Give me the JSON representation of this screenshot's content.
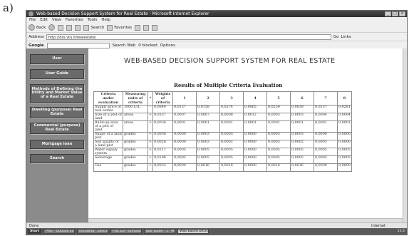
{
  "figure_label": "a)",
  "window": {
    "title": "Web-based Decision Support System for Real Estate - Microsoft Internet Explorer",
    "controls": [
      "_",
      "□",
      "x"
    ]
  },
  "menu": [
    "File",
    "Edit",
    "View",
    "Favorites",
    "Tools",
    "Help"
  ],
  "toolbar": {
    "back": "Back",
    "search": "Search",
    "favorites": "Favorites"
  },
  "address": {
    "label": "Address",
    "value": "http://dss.vtu.lt/realestate/",
    "go": "Go",
    "links": "Links"
  },
  "google": {
    "logo": "Google",
    "search": "Search Web",
    "blocked": "0 blocked",
    "options": "Options"
  },
  "sidebar": {
    "items": [
      {
        "label": "User"
      },
      {
        "label": "User Guide"
      },
      {
        "label": "Methods of Defining the Utility and Market Value of a Real Estate"
      },
      {
        "label": "Dwelling (purpose) Real Estate"
      },
      {
        "label": "Commercial (purpose) Real Estate"
      },
      {
        "label": "Mortgage loan"
      },
      {
        "label": "Search"
      }
    ]
  },
  "main": {
    "app_title": "WEB-BASED DECISION SUPPORT SYSTEM FOR REAL ESTATE",
    "results_title": "Results of Multiple Criteria Evaluation"
  },
  "table": {
    "headers": {
      "criteria": "Criteria under evaluation",
      "units": "Measuring units of criteria",
      "sign": "*",
      "weights": "Weights of criteria",
      "alternatives": [
        "1",
        "2",
        "3",
        "4",
        "5",
        "6",
        "7",
        "8"
      ]
    },
    "rows": [
      {
        "criterion": "Supply price of real estate",
        "unit": "1000 LTL",
        "sign": "-",
        "weight": "0,0640",
        "values": [
          "0,0137",
          "0,0158",
          "0,0274",
          "0,0065",
          "0,0259",
          "0,0039",
          "0,0137",
          "0,0281"
        ]
      },
      {
        "criterion": "Size of a plot of land",
        "unit": "areas",
        "sign": "+",
        "weight": "0,0337",
        "values": [
          "0,0007",
          "0,0007",
          "0,0008",
          "0,0012",
          "0,0003",
          "0,0003",
          "0,0004",
          "0,0004"
        ]
      },
      {
        "criterion": "Build-up area of a plot of land",
        "unit": "areas",
        "sign": "+",
        "weight": "0,0036",
        "values": [
          "0,0001",
          "0,0001",
          "0,0001",
          "0,0001",
          "0,0001",
          "0,0001",
          "0,0001",
          "0,0001"
        ]
      },
      {
        "criterion": "Shape of a land plot",
        "unit": "grades",
        "sign": "+",
        "weight": "0,0036",
        "values": [
          "0,0000",
          "0,0003",
          "0,0003",
          "0,0000",
          "0,0003",
          "0,0003",
          "0,0000",
          "0,0000"
        ]
      },
      {
        "criterion": "Soil quality of a land plot",
        "unit": "grades",
        "sign": "+",
        "weight": "0,0026",
        "values": [
          "0,0000",
          "0,0003",
          "0,0002",
          "0,0000",
          "0,0003",
          "0,0002",
          "0,0003",
          "0,0000"
        ]
      },
      {
        "criterion": "Water supply system",
        "unit": "grades",
        "sign": "+",
        "weight": "0,0211",
        "values": [
          "0,0005",
          "0,0005",
          "0,0005",
          "0,0000",
          "0,0005",
          "0,0005",
          "0,0005",
          "0,0005"
        ]
      },
      {
        "criterion": "Sewerage",
        "unit": "grades",
        "sign": "+",
        "weight": "0,0196",
        "values": [
          "0,0005",
          "0,0005",
          "0,0005",
          "0,0000",
          "0,0005",
          "0,0005",
          "0,0005",
          "0,0005"
        ]
      },
      {
        "criterion": "Gas",
        "unit": "grades",
        "sign": "+",
        "weight": "0,0032",
        "values": [
          "0,0000",
          "0,0016",
          "0,0016",
          "0,0000",
          "0,0016",
          "0,0016",
          "0,0000",
          "0,0000"
        ]
      }
    ]
  },
  "status": {
    "left": "Done",
    "right": "Internet"
  },
  "taskbar": {
    "start": "Start",
    "tasks": [
      "Prec - Outlook Express",
      "Inovaling - policies_br...",
      "FOL ED - symposium",
      "Ibar guide - 1 - Mic...",
      "Web-based Decisi..."
    ],
    "clock": "13:2"
  },
  "colors": {
    "sidebar_bg": "#8b8b8b",
    "nav_button": "#6a6a6a",
    "titlebar": "#3a3a3a"
  }
}
